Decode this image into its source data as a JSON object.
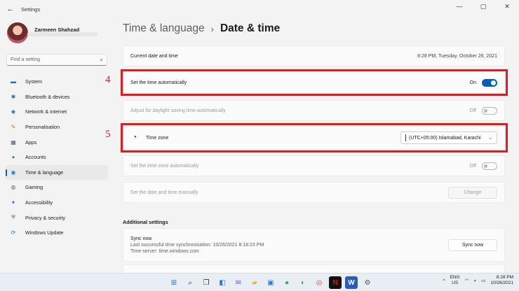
{
  "window": {
    "title": "Settings",
    "back_glyph": "←",
    "minimize_glyph": "—",
    "maximize_glyph": "▢",
    "close_glyph": "✕"
  },
  "profile": {
    "name": "Zarmeen Shahzad"
  },
  "search": {
    "placeholder": "Find a setting",
    "icon": "search-icon"
  },
  "nav": [
    {
      "label": "System",
      "icon": "monitor-icon",
      "glyph": "▬",
      "color": "#1e6fc9"
    },
    {
      "label": "Bluetooth & devices",
      "icon": "bluetooth-icon",
      "glyph": "✱",
      "color": "#1e6fc9"
    },
    {
      "label": "Network & internet",
      "icon": "wifi-icon",
      "glyph": "◆",
      "color": "#2a86d8"
    },
    {
      "label": "Personalisation",
      "icon": "brush-icon",
      "glyph": "✎",
      "color": "#c76a2b"
    },
    {
      "label": "Apps",
      "icon": "apps-icon",
      "glyph": "▦",
      "color": "#4b5f78"
    },
    {
      "label": "Accounts",
      "icon": "person-icon",
      "glyph": "●",
      "color": "#2aa273"
    },
    {
      "label": "Time & language",
      "icon": "globe-clock-icon",
      "glyph": "◉",
      "color": "#1e7fd0",
      "active": true
    },
    {
      "label": "Gaming",
      "icon": "gamepad-icon",
      "glyph": "◍",
      "color": "#6b6b6b"
    },
    {
      "label": "Accessibility",
      "icon": "accessibility-icon",
      "glyph": "✦",
      "color": "#1e6fc9"
    },
    {
      "label": "Privacy & security",
      "icon": "shield-icon",
      "glyph": "⛨",
      "color": "#5a6b80"
    },
    {
      "label": "Windows Update",
      "icon": "update-icon",
      "glyph": "⟳",
      "color": "#1e6fc9"
    }
  ],
  "breadcrumb": {
    "parent": "Time & language",
    "separator": "›",
    "current": "Date & time"
  },
  "settings": {
    "current_datetime": {
      "label": "Current date and time",
      "value": "8:28 PM, Tuesday, October 26, 2021"
    },
    "set_time_auto": {
      "label": "Set the time automatically",
      "state": "On"
    },
    "daylight": {
      "label": "Adjust for daylight saving time automatically",
      "state": "Off"
    },
    "time_zone": {
      "label": "Time zone",
      "value": "(UTC+05:00) Islamabad, Karachi",
      "chevron": "⌄"
    },
    "tz_auto": {
      "label": "Set the time zone automatically",
      "state": "Off"
    },
    "manual": {
      "label": "Set the date and time manually",
      "button": "Change"
    }
  },
  "additional": {
    "title": "Additional settings",
    "sync": {
      "title": "Sync now",
      "last_sync": "Last successful time synchronisation: 10/26/2021 8:18:23 PM",
      "server": "Time server: time.windows.com",
      "button": "Sync now"
    }
  },
  "annotations": {
    "first": "4",
    "second": "5",
    "color": "#e21b23"
  },
  "taskbar": {
    "apps": [
      {
        "name": "start-icon",
        "glyph": "⊞",
        "color": "#1a73d9"
      },
      {
        "name": "search-taskbar-icon",
        "glyph": "⌕",
        "color": "#333"
      },
      {
        "name": "task-view-icon",
        "glyph": "❐",
        "color": "#333"
      },
      {
        "name": "widgets-icon",
        "glyph": "◧",
        "color": "#2a7bd8"
      },
      {
        "name": "chat-icon",
        "glyph": "✉",
        "color": "#6c5ce7"
      },
      {
        "name": "file-explorer-icon",
        "glyph": "▰",
        "color": "#e6b73a"
      },
      {
        "name": "store-icon",
        "glyph": "▣",
        "color": "#2d7dd2"
      },
      {
        "name": "spotify-icon",
        "glyph": "●",
        "color": "#1db954"
      },
      {
        "name": "edge-icon",
        "glyph": "◐",
        "color": "#2fa36b"
      },
      {
        "name": "chrome-icon",
        "glyph": "◎",
        "color": "#e0453a"
      },
      {
        "name": "netflix-icon",
        "glyph": "N",
        "color": "#e50914"
      },
      {
        "name": "word-icon",
        "glyph": "W",
        "color": "#2b5cb8"
      },
      {
        "name": "settings-taskbar-icon",
        "glyph": "⚙",
        "color": "#555"
      }
    ],
    "tray_chevron": "^",
    "lang": "ENG",
    "region": "US",
    "time": "8:28 PM",
    "date": "10/26/2021"
  }
}
